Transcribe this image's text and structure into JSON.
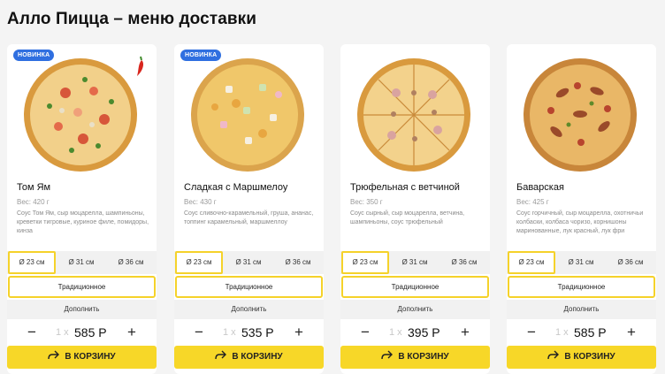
{
  "page": {
    "title": "Алло Пицца – меню доставки"
  },
  "icons": {
    "minus": "minus-icon",
    "plus": "plus-icon",
    "cart": "share-arrow-icon",
    "chili": "chili-pepper-icon"
  },
  "colors": {
    "accent": "#f7d728",
    "badge": "#2f6fe0"
  },
  "products": [
    {
      "badge": "НОВИНКА",
      "name": "Том Ям",
      "weight": "Вес: 420 г",
      "description": "Соус Том Ям, сыр моцарелла, шампиньоны, креветки тигровые, куриное филе, помидоры, кинза",
      "sizes": [
        "Ø 23 см",
        "Ø 31 см",
        "Ø 36 см"
      ],
      "dough": "Традиционное",
      "extra": "Дополнить",
      "minus": "−",
      "times": "1 x",
      "price": "585 Р",
      "plus": "+",
      "cart": "В КОРЗИНУ"
    },
    {
      "badge": "НОВИНКА",
      "name": "Сладкая с Маршмелоу",
      "weight": "Вес: 430 г",
      "description": "Соус сливочно-карамельный, грушa, ананас, топпинг карамельный, маршмеллоу",
      "sizes": [
        "Ø 23 см",
        "Ø 31 см",
        "Ø 36 см"
      ],
      "dough": "Традиционное",
      "extra": "Дополнить",
      "minus": "−",
      "times": "1 x",
      "price": "535 Р",
      "plus": "+",
      "cart": "В КОРЗИНУ"
    },
    {
      "badge": "",
      "name": "Трюфельная с ветчиной",
      "weight": "Вес: 350 г",
      "description": "Соус сырный, сыр моцарелла, ветчина, шампиньоны, соус трюфельный",
      "sizes": [
        "Ø 23 см",
        "Ø 31 см",
        "Ø 36 см"
      ],
      "dough": "Традиционное",
      "extra": "Дополнить",
      "minus": "−",
      "times": "1 x",
      "price": "395 Р",
      "plus": "+",
      "cart": "В КОРЗИНУ"
    },
    {
      "badge": "",
      "name": "Баварская",
      "weight": "Вес: 425 г",
      "description": "Соус горчичный, сыр моцарелла, охотничьи колбаски, колбаса чоризо, корнишоны маринованные, лук красный, лук фри",
      "sizes": [
        "Ø 23 см",
        "Ø 31 см",
        "Ø 36 см"
      ],
      "dough": "Традиционное",
      "extra": "Дополнить",
      "minus": "−",
      "times": "1 x",
      "price": "585 Р",
      "plus": "+",
      "cart": "В КОРЗИНУ"
    }
  ]
}
